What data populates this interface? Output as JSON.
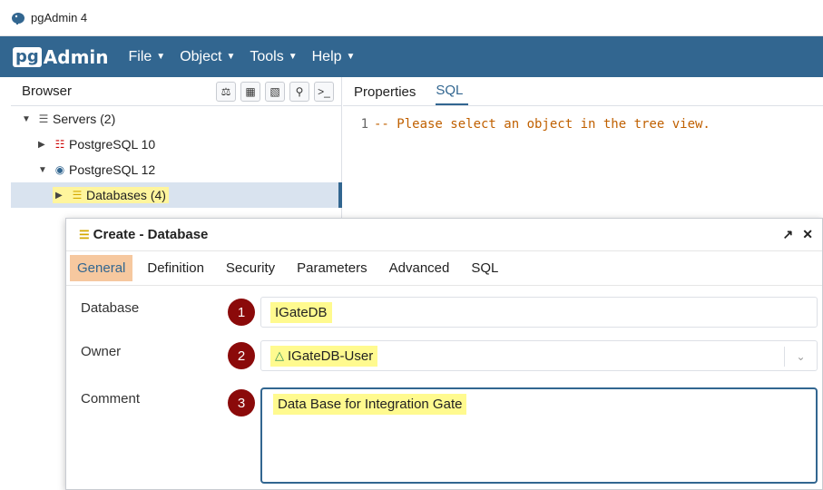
{
  "window": {
    "title": "pgAdmin 4"
  },
  "menubar": {
    "logo_prefix": "pg",
    "logo_suffix": "Admin",
    "items": [
      {
        "label": "File",
        "icon": "chevron-down-icon"
      },
      {
        "label": "Object",
        "icon": "chevron-down-icon"
      },
      {
        "label": "Tools",
        "icon": "chevron-down-icon"
      },
      {
        "label": "Help",
        "icon": "chevron-down-icon"
      }
    ]
  },
  "browser": {
    "title": "Browser",
    "toolbar": [
      "database-query-icon",
      "table-grid-icon",
      "filter-table-icon",
      "search-icon",
      "terminal-icon"
    ],
    "tree": [
      {
        "label": "Servers (2)",
        "expanded": true,
        "icon": "servers-icon"
      },
      {
        "label": "PostgreSQL 10",
        "expanded": false,
        "icon": "server-disconnected-icon"
      },
      {
        "label": "PostgreSQL 12",
        "expanded": true,
        "icon": "elephant-icon"
      },
      {
        "label": "Databases (4)",
        "expanded": false,
        "icon": "database-icon",
        "selected": true
      }
    ]
  },
  "right_panel": {
    "tabs": [
      {
        "label": "Properties",
        "active": false
      },
      {
        "label": "SQL",
        "active": true
      }
    ],
    "sql_line_number": "1",
    "sql_text": "-- Please select an object in the tree view."
  },
  "dialog": {
    "title": "Create - Database",
    "tabs": [
      {
        "label": "General",
        "active": true
      },
      {
        "label": "Definition",
        "active": false
      },
      {
        "label": "Security",
        "active": false
      },
      {
        "label": "Parameters",
        "active": false
      },
      {
        "label": "Advanced",
        "active": false
      },
      {
        "label": "SQL",
        "active": false
      }
    ],
    "fields": {
      "database": {
        "label": "Database",
        "value": "IGateDB",
        "badge": "1"
      },
      "owner": {
        "label": "Owner",
        "value": "IGateDB-User",
        "badge": "2"
      },
      "comment": {
        "label": "Comment",
        "value": "Data Base for Integration Gate",
        "badge": "3"
      }
    }
  },
  "colors": {
    "menubar": "#326690",
    "active_tab": "#f6c89f",
    "highlight": "#fffa8f",
    "badge": "#8b0a0a"
  }
}
